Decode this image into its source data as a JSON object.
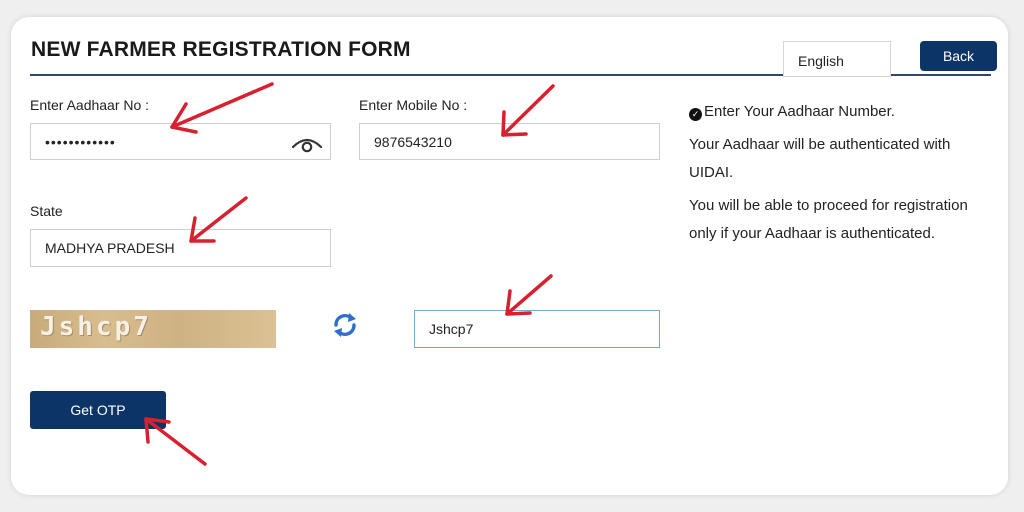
{
  "form": {
    "title": "NEW FARMER REGISTRATION FORM",
    "language": "English",
    "back_label": "Back",
    "aadhaar_label": "Enter Aadhaar No :",
    "aadhaar_value": "••••••••••••",
    "mobile_label": "Enter Mobile No :",
    "mobile_value": "9876543210",
    "state_label": "State",
    "state_value": "MADHYA PRADESH",
    "captcha_text": "Jshcp7",
    "captcha_input_value": "Jshcp7",
    "otp_label": "Get OTP"
  },
  "info": {
    "line1": "Enter Your Aadhaar Number.",
    "line2": "Your Aadhaar will be authenticated with UIDAI.",
    "line3": "You will be able to proceed for registration only if your Aadhaar is authenticated."
  },
  "colors": {
    "primary": "#0c3466",
    "rule": "#2d4a6b",
    "refresh": "#2f6fc9",
    "annotation": "#d8212f"
  },
  "icons": {
    "eye": "eye-icon",
    "refresh": "refresh-icon",
    "check": "check-circle-icon"
  }
}
